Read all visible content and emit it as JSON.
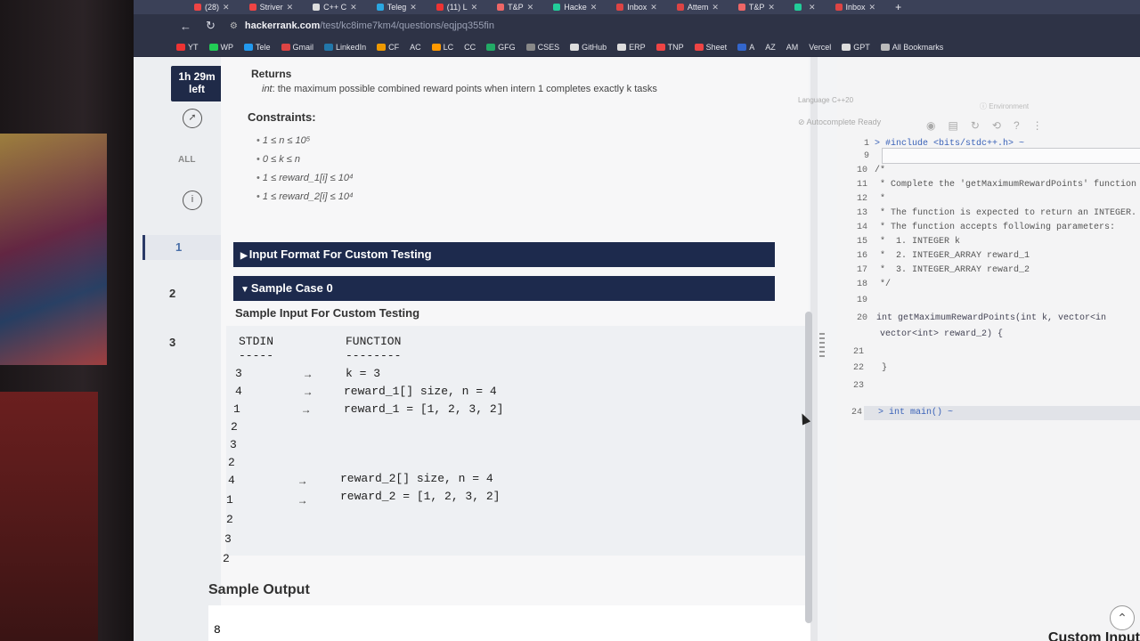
{
  "browser": {
    "tabs": [
      "(28)",
      "Striver",
      "C++ C",
      "Teleg",
      "(11) L",
      "T&P",
      "Hacke",
      "Inbox",
      "Attem",
      "T&P",
      "",
      "Inbox"
    ],
    "new_tab": "+",
    "url_host": "hackerrank.com",
    "url_path": "/test/kc8ime7km4/questions/eqjpq355fin",
    "bookmarks": [
      "YT",
      "WP",
      "Tele",
      "Gmail",
      "LinkedIn",
      "CF",
      "AC",
      "LC",
      "CC",
      "GFG",
      "CSES",
      "GitHub",
      "ERP",
      "TNP",
      "Sheet",
      "A",
      "AZ",
      "AM",
      "Vercel",
      "GPT",
      "All Bookmarks"
    ]
  },
  "timer": {
    "line1": "1h 29m",
    "line2": "left"
  },
  "rail": {
    "all_label": "ALL",
    "questions": [
      "1",
      "2",
      "3"
    ]
  },
  "problem": {
    "returns_title": "Returns",
    "returns_type": "int",
    "returns_desc": ": the maximum possible combined reward points when intern 1 completes exactly k tasks",
    "constraints_title": "Constraints:",
    "constraints": [
      "1 ≤ n ≤ 10⁵",
      "0 ≤ k ≤ n",
      "1 ≤ reward_1[i] ≤ 10⁴",
      "1 ≤ reward_2[i] ≤ 10⁴"
    ],
    "input_format_bar": "Input Format For Custom Testing",
    "sample_case_bar": "Sample Case 0",
    "sample_input_title": "Sample Input For Custom Testing",
    "stdin_header": "STDIN",
    "function_header": "FUNCTION",
    "stdin_dash": "-----",
    "function_dash": "--------",
    "stdin_values": [
      "3",
      "4",
      "1",
      "2",
      "3",
      "2",
      "4",
      "1",
      "2",
      "3",
      "2"
    ],
    "function_lines": [
      "k = 3",
      "reward_1[] size, n = 4",
      "reward_1 = [1, 2, 3, 2]",
      "reward_2[] size, n = 4",
      "reward_2 = [1, 2, 3, 2]"
    ],
    "arrow": "→",
    "sample_output_title": "Sample Output",
    "sample_output_value": "8"
  },
  "editor": {
    "language_label": "Language",
    "language_value": "C++20",
    "environment_label": "Environment",
    "autocomplete_label": "Autocomplete Ready",
    "lines": [
      {
        "n": "1",
        "text": "> #include <bits/stdc++.h> ~"
      },
      {
        "n": "9",
        "text": ""
      },
      {
        "n": "10",
        "text": "/*"
      },
      {
        "n": "11",
        "text": " * Complete the 'getMaximumRewardPoints' function b"
      },
      {
        "n": "12",
        "text": " *"
      },
      {
        "n": "13",
        "text": " * The function is expected to return an INTEGER."
      },
      {
        "n": "14",
        "text": " * The function accepts following parameters:"
      },
      {
        "n": "15",
        "text": " *  1. INTEGER k"
      },
      {
        "n": "16",
        "text": " *  2. INTEGER_ARRAY reward_1"
      },
      {
        "n": "17",
        "text": " *  3. INTEGER_ARRAY reward_2"
      },
      {
        "n": "18",
        "text": " */"
      },
      {
        "n": "19",
        "text": ""
      },
      {
        "n": "20",
        "text": "int getMaximumRewardPoints(int k, vector<in"
      },
      {
        "n": "",
        "text": "vector<int> reward_2) {"
      },
      {
        "n": "21",
        "text": ""
      },
      {
        "n": "22",
        "text": "}"
      },
      {
        "n": "23",
        "text": ""
      },
      {
        "n": "24",
        "text": "> int main() ~"
      }
    ],
    "custom_input_label": "Custom Input"
  },
  "colors": {
    "bar": "#1d2a4d",
    "accent": "#3a62b8"
  }
}
